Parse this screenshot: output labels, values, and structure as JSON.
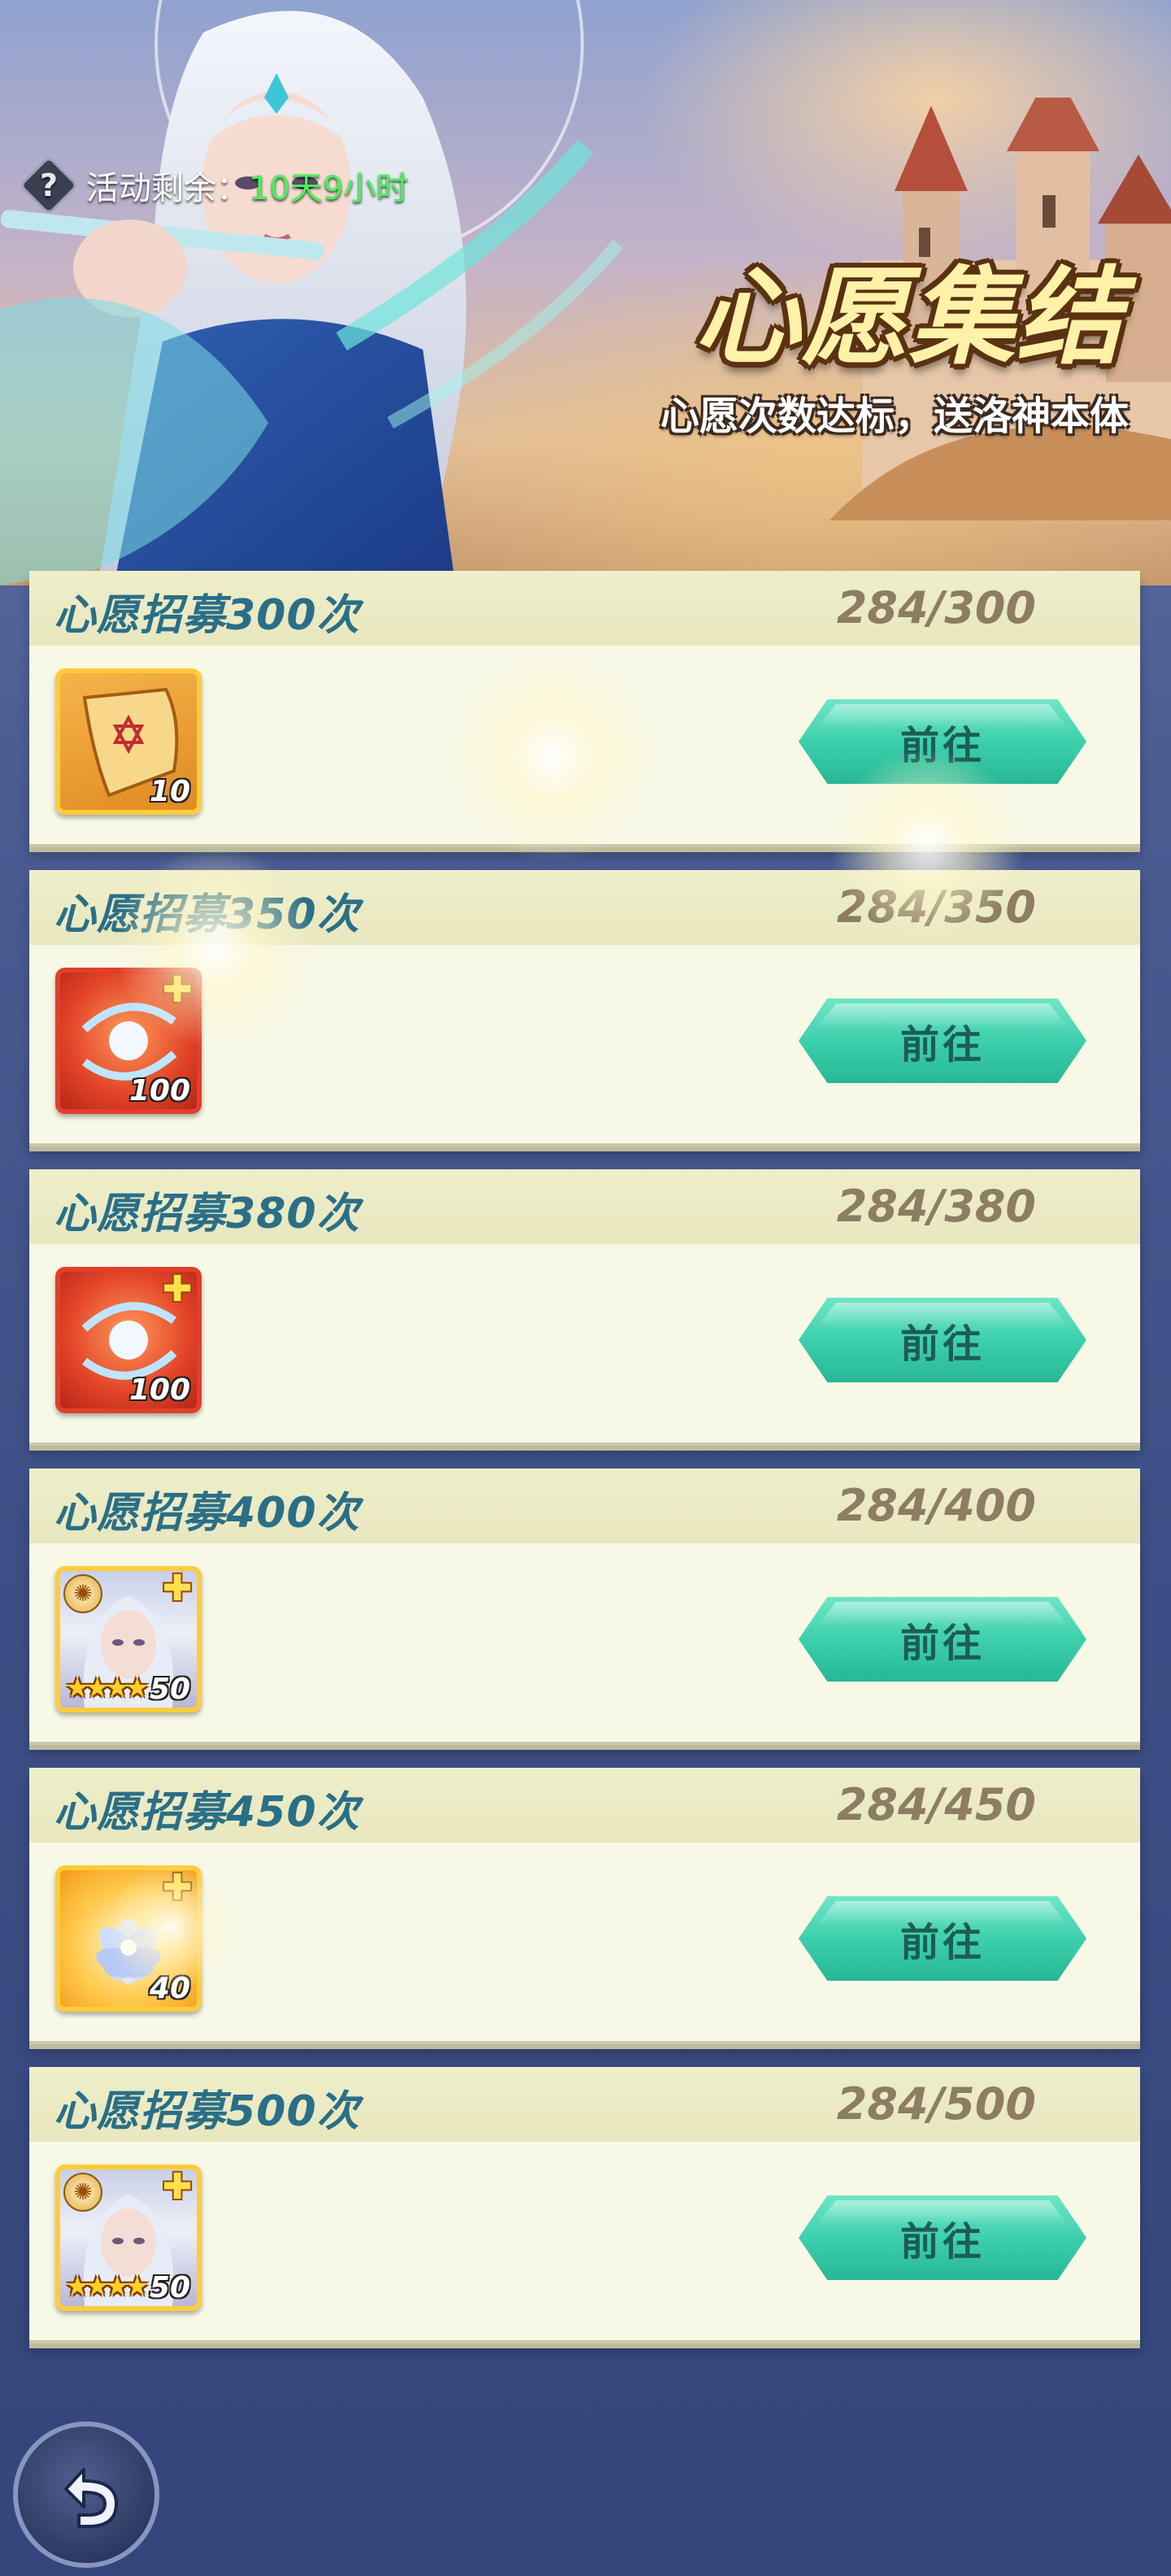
{
  "header": {
    "help_icon": "help-icon",
    "timer_label": "活动剩余：",
    "timer_value": "10天9小时",
    "title": "心愿集结",
    "subtitle": "心愿次数达标，送洛神本体"
  },
  "milestones": [
    {
      "label": "心愿招募300次",
      "progress": "284/300",
      "reward_icon": "scroll-icon",
      "reward_count": "10",
      "button": "前往"
    },
    {
      "label": "心愿招募350次",
      "progress": "284/350",
      "reward_icon": "orb-icon",
      "reward_count": "100",
      "button": "前往"
    },
    {
      "label": "心愿招募380次",
      "progress": "284/380",
      "reward_icon": "orb-icon",
      "reward_count": "100",
      "button": "前往"
    },
    {
      "label": "心愿招募400次",
      "progress": "284/400",
      "reward_icon": "hero-portrait-icon",
      "reward_count": "50",
      "button": "前往"
    },
    {
      "label": "心愿招募450次",
      "progress": "284/450",
      "reward_icon": "lotus-icon",
      "reward_count": "40",
      "button": "前往"
    },
    {
      "label": "心愿招募500次",
      "progress": "284/500",
      "reward_icon": "hero-portrait-icon",
      "reward_count": "50",
      "button": "前往"
    }
  ],
  "footer": {
    "back_icon": "back-arrow-icon"
  }
}
